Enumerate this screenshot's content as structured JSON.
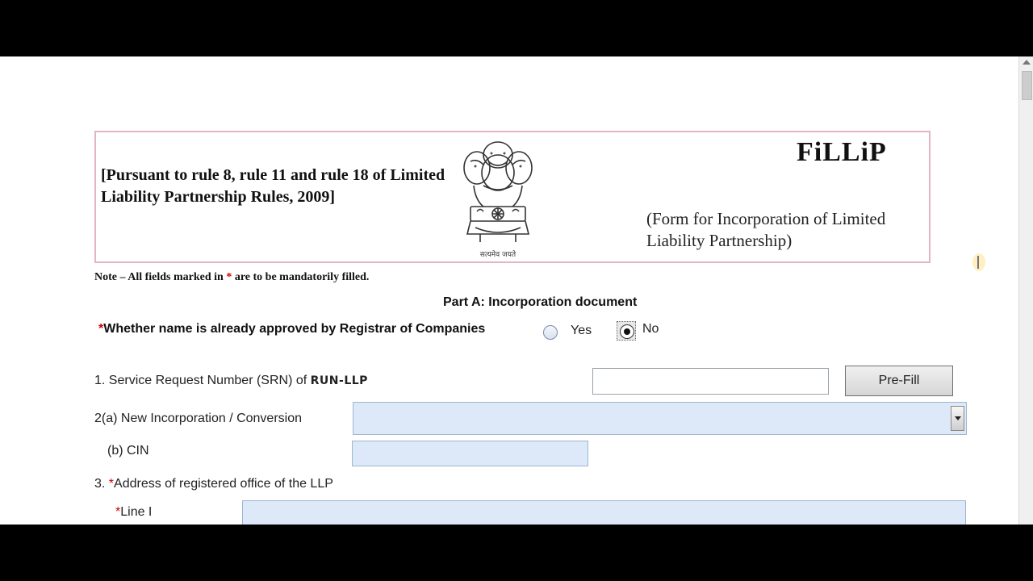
{
  "header": {
    "rule_text": "[Pursuant to rule 8, rule 11 and rule 18 of Limited Liability Partnership Rules, 2009]",
    "emblem_caption": "सत्यमेव जयते",
    "form_name": "FiLLiP",
    "form_description": "(Form for Incorporation of Limited Liability Partnership)"
  },
  "note": {
    "prefix": "Note – All fields marked in ",
    "asterisk": "*",
    "suffix": " are to be mandatorily filled."
  },
  "part_title": "Part A:  Incorporation document",
  "question_approved": {
    "asterisk": "*",
    "label": "Whether name is already approved by Registrar of Companies",
    "options": [
      "Yes",
      "No"
    ],
    "selected": "No"
  },
  "srn": {
    "label": "1. Service Request Number (SRN) of ",
    "label_emphasis": "RUN-LLP",
    "value": "",
    "prefill_label": "Pre-Fill"
  },
  "incorporation": {
    "label": "2(a) New Incorporation / Conversion",
    "selected": ""
  },
  "cin": {
    "label": "(b) CIN",
    "value": ""
  },
  "address": {
    "label_prefix": "3. ",
    "asterisk": "*",
    "label": "Address of registered office of the LLP",
    "line1_asterisk": "*",
    "line1_label": "Line I",
    "line1_value": ""
  },
  "colors": {
    "field_bg": "#dde9f8",
    "header_border": "#e3b5c4",
    "required": "#d00000"
  }
}
